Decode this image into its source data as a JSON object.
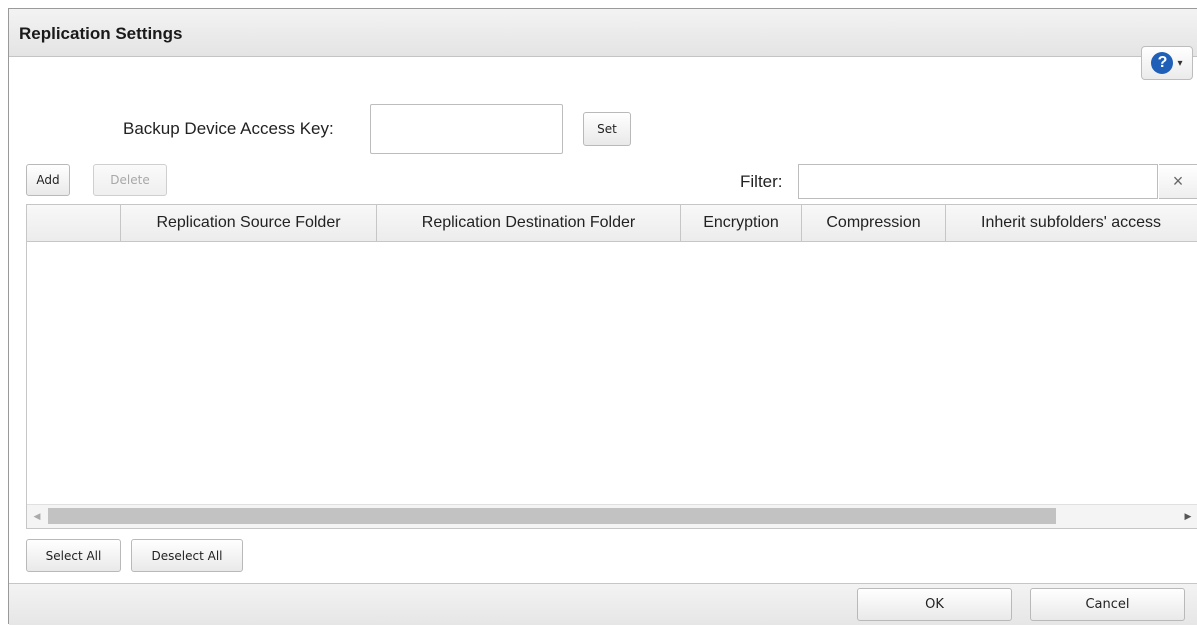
{
  "dialog": {
    "title": "Replication Settings"
  },
  "help": {
    "glyph": "?",
    "caret": "▾",
    "icon": "help-circle-icon",
    "accent": "#1f5fb8"
  },
  "access_key": {
    "label": "Backup Device Access Key:",
    "value": "",
    "set_label": "Set"
  },
  "toolbar": {
    "add_label": "Add",
    "delete_label": "Delete"
  },
  "filter": {
    "label": "Filter:",
    "value": "",
    "clear_glyph": "×"
  },
  "table": {
    "columns": [
      "",
      "Replication Source Folder",
      "Replication Destination Folder",
      "Encryption",
      "Compression",
      "Inherit subfolders' access"
    ],
    "rows": []
  },
  "scrollbar": {
    "left_glyph": "◀",
    "right_glyph": "▶"
  },
  "selection": {
    "select_all_label": "Select All",
    "deselect_all_label": "Deselect All"
  },
  "footer": {
    "ok_label": "OK",
    "cancel_label": "Cancel"
  }
}
